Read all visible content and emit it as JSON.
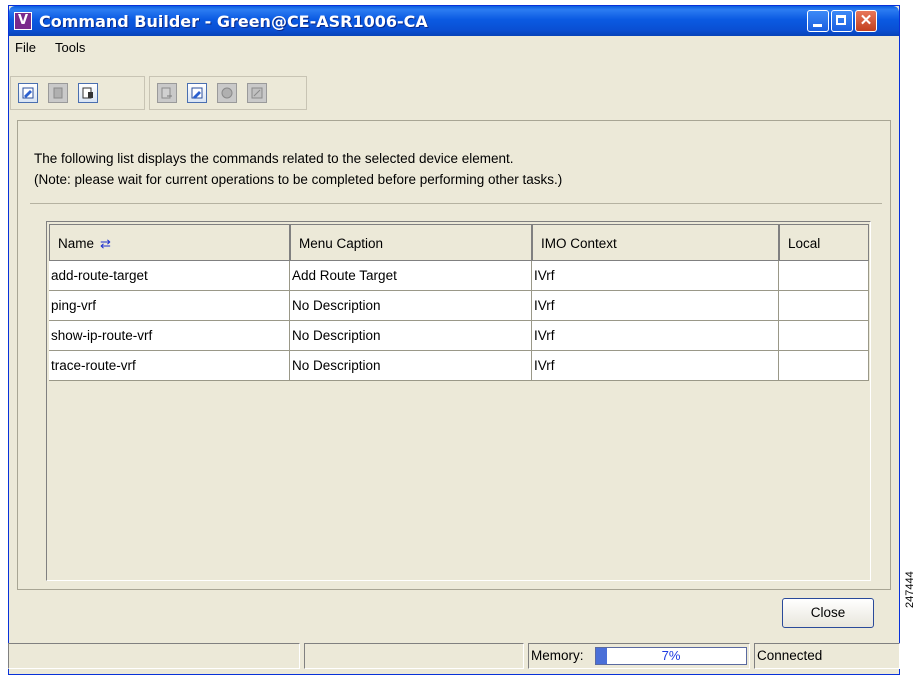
{
  "window": {
    "title": "Command Builder - Green@CE-ASR1006-CA",
    "app_icon_letter": "V"
  },
  "menubar": {
    "items": [
      "File",
      "Tools"
    ]
  },
  "toolbar": {
    "group1": [
      {
        "name": "edit-command-icon",
        "enabled": true
      },
      {
        "name": "new-command-icon",
        "enabled": false
      },
      {
        "name": "delete-command-icon",
        "enabled": true
      }
    ],
    "group2": [
      {
        "name": "import-command-icon",
        "enabled": false
      },
      {
        "name": "export-command-icon",
        "enabled": true
      },
      {
        "name": "deploy-command-icon",
        "enabled": false
      },
      {
        "name": "view-command-icon",
        "enabled": false
      }
    ]
  },
  "description": {
    "line1": "The following list displays the commands related to the selected device element.",
    "line2": "(Note: please wait for current operations to be completed before performing other tasks.)"
  },
  "table": {
    "columns": [
      "Name",
      "Menu Caption",
      "IMO Context",
      "Local"
    ],
    "rows": [
      [
        "add-route-target",
        "Add Route Target",
        "IVrf",
        ""
      ],
      [
        "ping-vrf",
        "No Description",
        "IVrf",
        ""
      ],
      [
        "show-ip-route-vrf",
        "No Description",
        "IVrf",
        ""
      ],
      [
        "trace-route-vrf",
        "No Description",
        "IVrf",
        ""
      ]
    ]
  },
  "buttons": {
    "close_label": "Close"
  },
  "statusbar": {
    "memory_label": "Memory:",
    "memory_value": "7%",
    "memory_fraction": 0.07,
    "connection": "Connected"
  },
  "side_label": "247444",
  "colors": {
    "title_bar": "#0a5ddf",
    "window_bg": "#ece9d8",
    "memory_text": "#1c3ae0"
  }
}
